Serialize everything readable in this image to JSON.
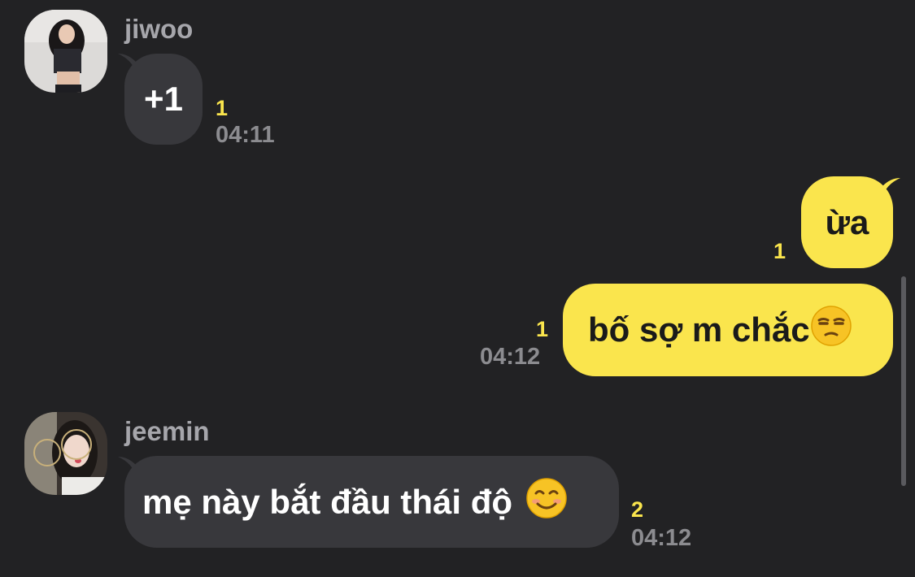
{
  "messages": [
    {
      "sender": "jiwoo",
      "text": "+1",
      "unread": "1",
      "time": "04:11",
      "direction": "incoming"
    },
    {
      "sender": "",
      "text": "ừa",
      "unread": "1",
      "time": "",
      "direction": "outgoing"
    },
    {
      "sender": "",
      "text": "bố sợ m chắc",
      "emoji": "unamused-face",
      "unread": "1",
      "time": "04:12",
      "direction": "outgoing"
    },
    {
      "sender": "jeemin",
      "text": "mẹ này bắt đầu thái độ",
      "emoji": "smiling-face",
      "unread": "2",
      "time": "04:12",
      "direction": "incoming"
    }
  ],
  "colors": {
    "background": "#222224",
    "incoming_bubble": "#38383c",
    "outgoing_bubble": "#fae54d",
    "unread_count": "#fae54d",
    "timestamp": "#8c8c90",
    "sender_name": "#a6a6ab"
  }
}
